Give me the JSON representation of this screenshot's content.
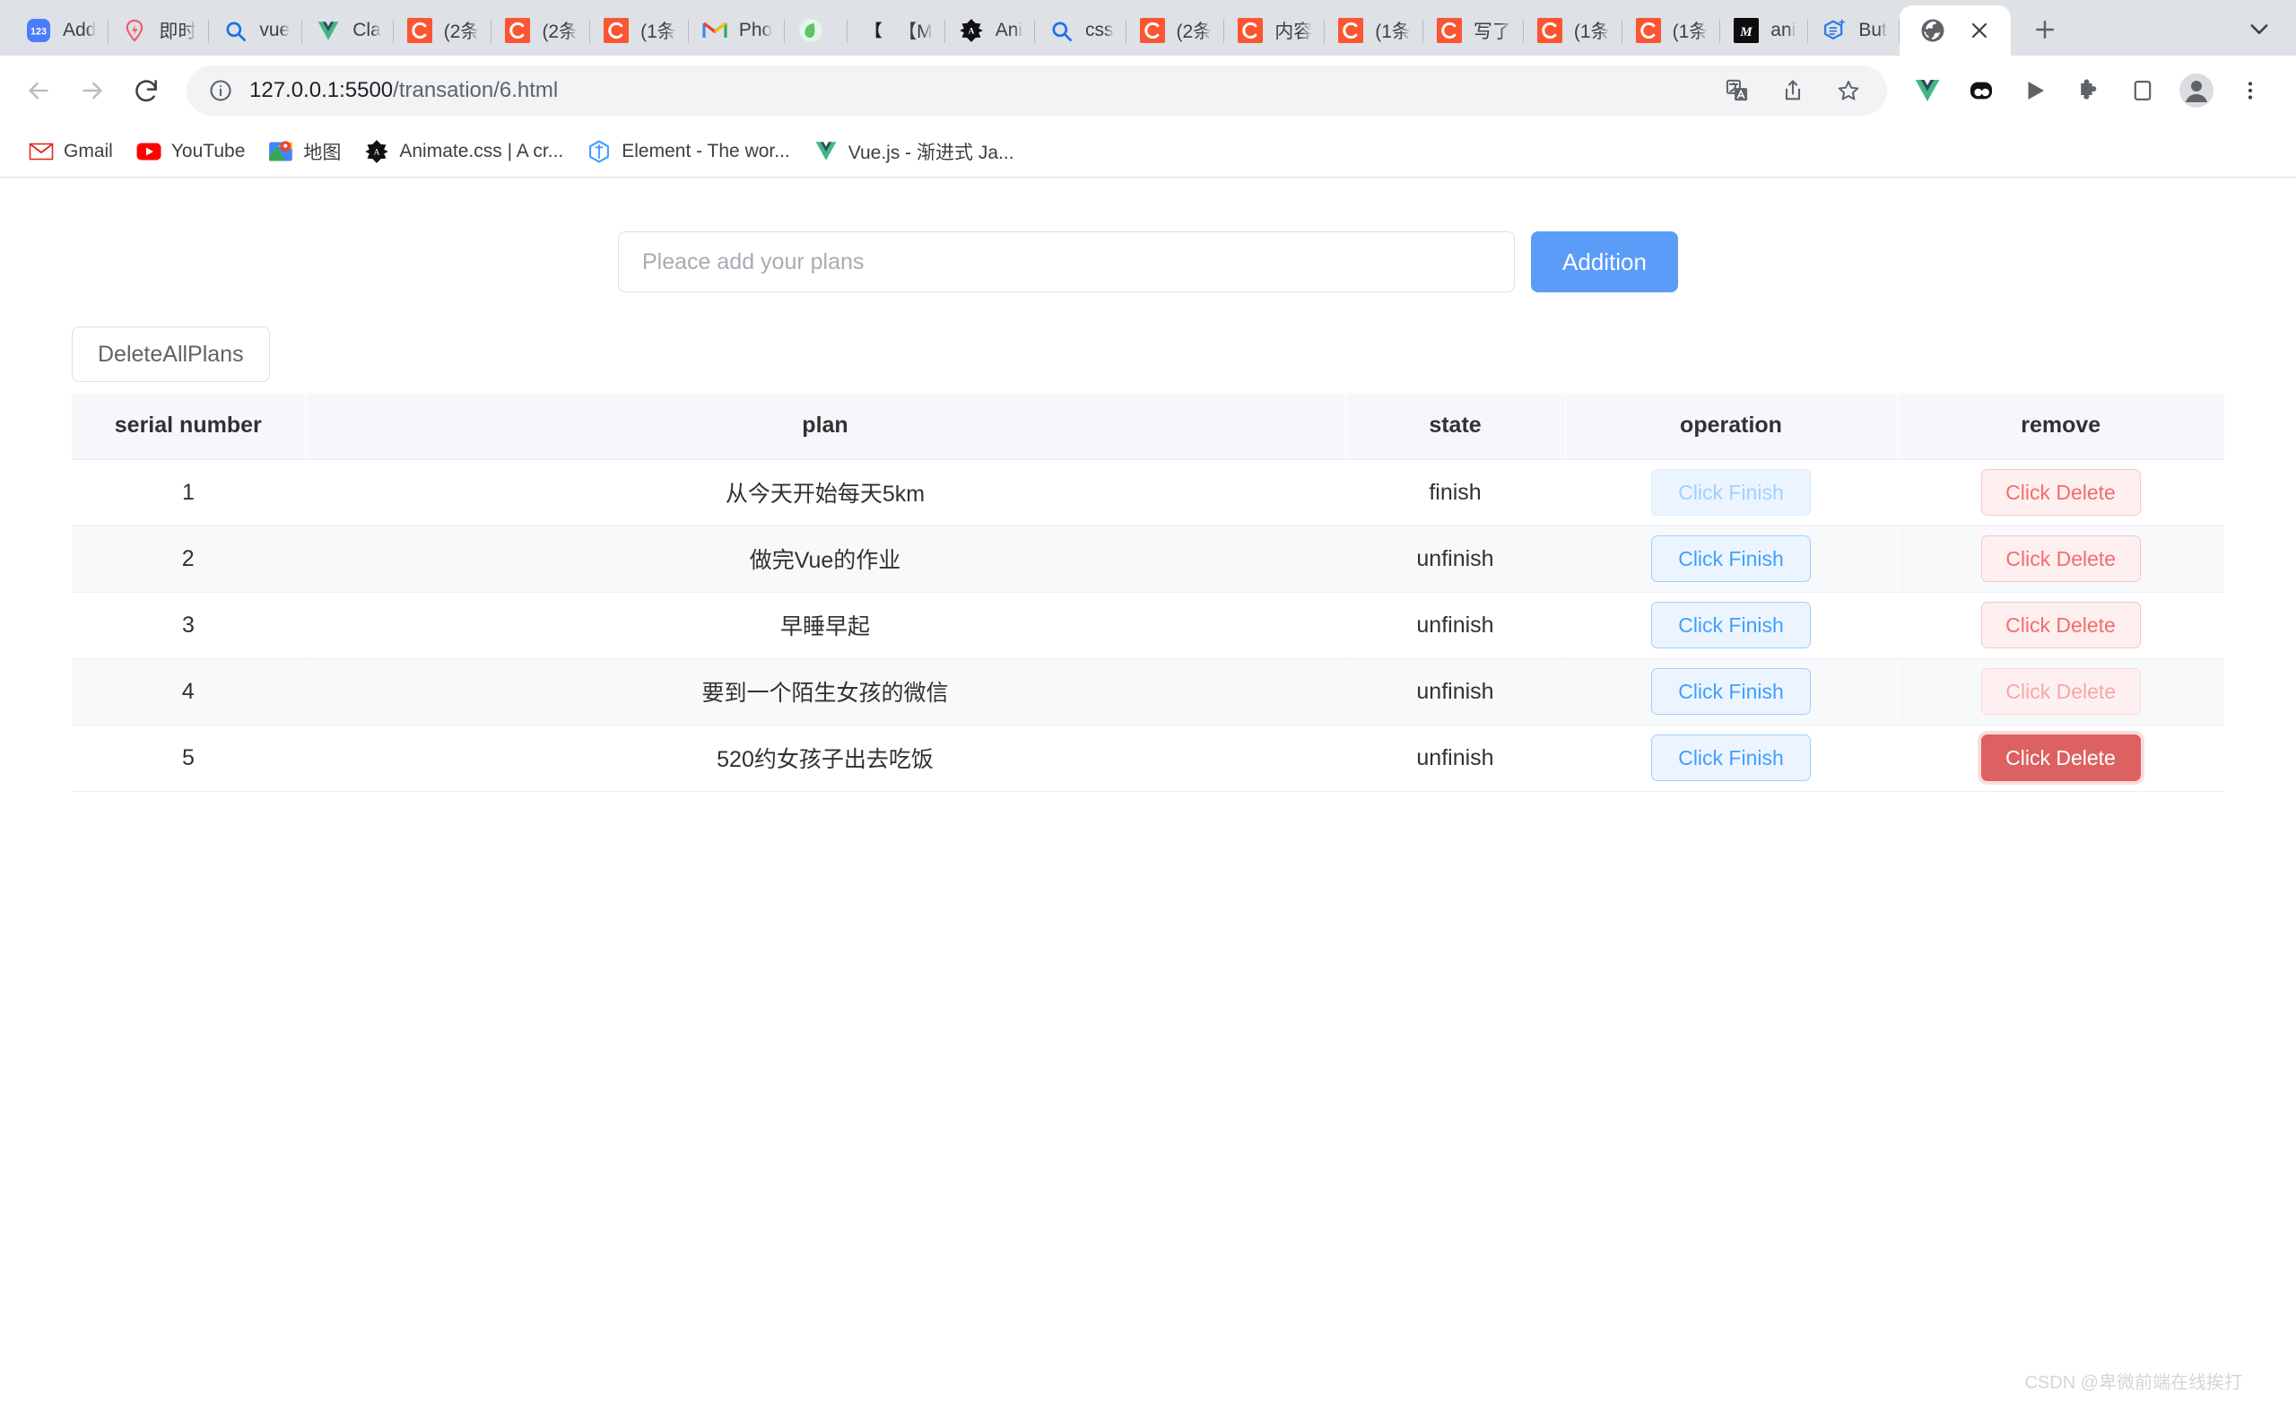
{
  "browser": {
    "tabs": [
      {
        "title": "Add",
        "icon": "num123-icon"
      },
      {
        "title": "即时",
        "icon": "jishi-icon"
      },
      {
        "title": "vue",
        "icon": "search-icon"
      },
      {
        "title": "Cla",
        "icon": "vue-icon"
      },
      {
        "title": "(2条",
        "icon": "csdn-icon"
      },
      {
        "title": "(2条",
        "icon": "csdn-icon"
      },
      {
        "title": "(1条",
        "icon": "csdn-icon"
      },
      {
        "title": "Pho",
        "icon": "gmail-icon"
      },
      {
        "title": "",
        "icon": "leaf-icon"
      },
      {
        "title": "【M",
        "icon": "bracket-icon"
      },
      {
        "title": "Ani",
        "icon": "animate-icon"
      },
      {
        "title": "css",
        "icon": "search-icon"
      },
      {
        "title": "(2条",
        "icon": "csdn-icon"
      },
      {
        "title": "内容",
        "icon": "csdn-icon"
      },
      {
        "title": "(1条",
        "icon": "csdn-icon"
      },
      {
        "title": "写了",
        "icon": "csdn-icon"
      },
      {
        "title": "(1条",
        "icon": "csdn-icon"
      },
      {
        "title": "(1条",
        "icon": "csdn-icon"
      },
      {
        "title": "ani",
        "icon": "m4-icon"
      },
      {
        "title": "But",
        "icon": "bluehex-icon"
      }
    ],
    "active_tab": {
      "title": "",
      "icon": "globe-icon"
    },
    "new_tab_label": "+",
    "url_host": "127.0.0.1:5500",
    "url_path": "/transation/6.html",
    "bookmarks": [
      {
        "label": "Gmail",
        "icon": "gmail-icon"
      },
      {
        "label": "YouTube",
        "icon": "youtube-icon"
      },
      {
        "label": "地图",
        "icon": "maps-icon"
      },
      {
        "label": "Animate.css | A cr...",
        "icon": "animate-icon"
      },
      {
        "label": "Element - The wor...",
        "icon": "element-icon"
      },
      {
        "label": "Vue.js - 渐进式 Ja...",
        "icon": "vue-icon"
      }
    ],
    "toolbar_icons": [
      "translate-icon",
      "share-icon",
      "bookmark-star-icon",
      "vue-devtools-icon",
      "extension-dark-icon",
      "play-icon",
      "puzzle-extensions-icon",
      "side-panel-icon",
      "profile-avatar-icon",
      "more-menu-icon"
    ]
  },
  "app": {
    "input_placeholder": "Pleace add your plans",
    "input_value": "",
    "addition_label": "Addition",
    "delete_all_label": "DeleteAllPlans",
    "columns": [
      "serial number",
      "plan",
      "state",
      "operation",
      "remove"
    ],
    "finish_label": "Click Finish",
    "delete_label": "Click Delete",
    "rows": [
      {
        "serial": "1",
        "plan": "从今天开始每天5km",
        "state": "finish",
        "finish_state": "disabled",
        "delete_state": "normal"
      },
      {
        "serial": "2",
        "plan": "做完Vue的作业",
        "state": "unfinish",
        "finish_state": "normal",
        "delete_state": "normal"
      },
      {
        "serial": "3",
        "plan": "早睡早起",
        "state": "unfinish",
        "finish_state": "normal",
        "delete_state": "normal"
      },
      {
        "serial": "4",
        "plan": "要到一个陌生女孩的微信",
        "state": "unfinish",
        "finish_state": "normal",
        "delete_state": "faded"
      },
      {
        "serial": "5",
        "plan": "520约女孩子出去吃饭",
        "state": "unfinish",
        "finish_state": "normal",
        "delete_state": "active"
      }
    ],
    "watermark": "CSDN @卑微前端在线挨打",
    "colors": {
      "primary": "#5a9cf8",
      "finish": "#409eff",
      "delete": "#f56c6c",
      "delete_active": "#dd6161",
      "header_bg": "#f5f7fa"
    }
  }
}
